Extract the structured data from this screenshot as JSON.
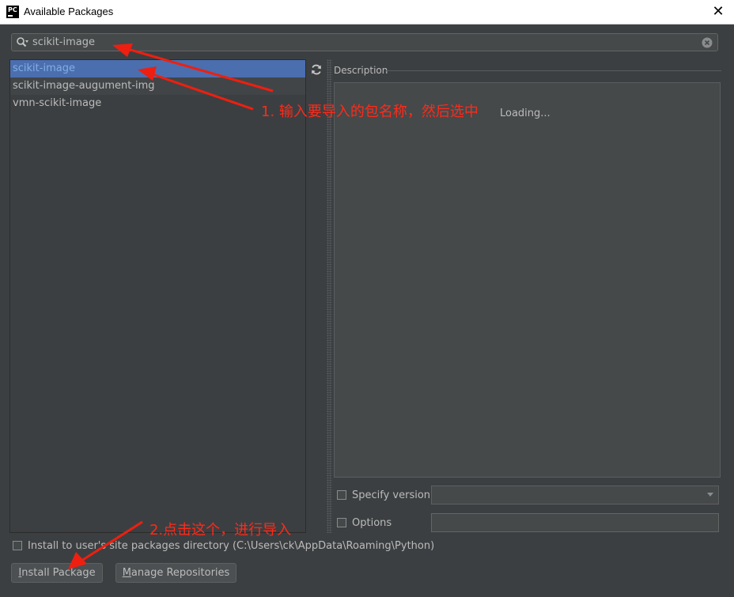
{
  "window": {
    "title": "Available Packages",
    "logo_text": "PC",
    "close_glyph": "✕"
  },
  "search": {
    "value": "scikit-image",
    "icon": "search-icon",
    "clear_icon": "clear-icon"
  },
  "packages": [
    {
      "name": "scikit-image",
      "selected": true
    },
    {
      "name": "scikit-image-augument-img",
      "selected": false
    },
    {
      "name": "vmn-scikit-image",
      "selected": false
    }
  ],
  "description": {
    "label": "Description",
    "loading_text": "Loading..."
  },
  "specify_version": {
    "label": "Specify version",
    "checked": false,
    "value": ""
  },
  "options": {
    "label": "Options",
    "checked": false,
    "value": ""
  },
  "install_to_user": {
    "label": "Install to user's site packages directory (C:\\Users\\ck\\AppData\\Roaming\\Python)",
    "checked": false
  },
  "buttons": {
    "install_mnemonic": "I",
    "install_rest": "nstall Package",
    "manage_mnemonic": "M",
    "manage_rest": "anage Repositories"
  },
  "annotations": {
    "step1": "1. 输入要导入的包名称，然后选中",
    "step2": "2.点击这个，进行导入",
    "color": "#ff2a1a"
  },
  "colors": {
    "background": "#3c3f41",
    "selection": "#4b6eaf",
    "selected_text": "#82aee3",
    "text": "#bbbbbb"
  }
}
